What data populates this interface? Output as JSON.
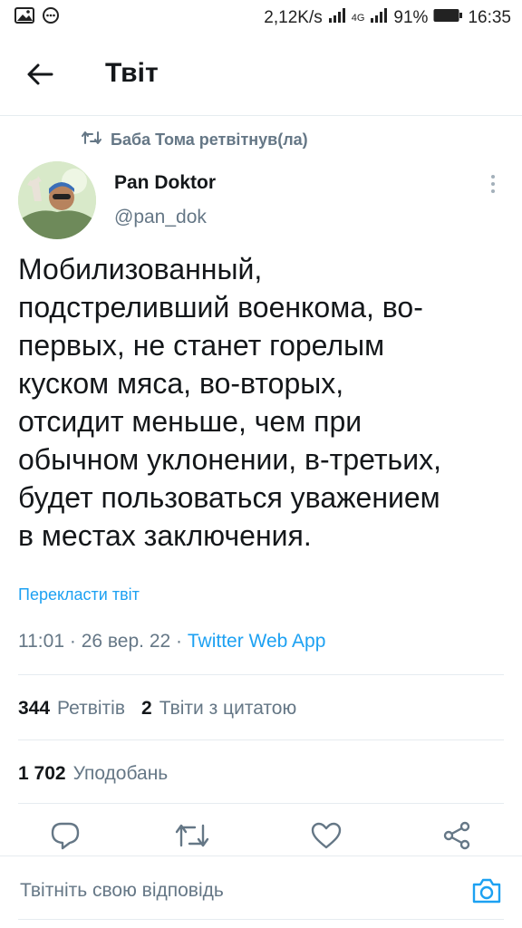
{
  "status_bar": {
    "speed": "2,12K/s",
    "network": "4G",
    "battery": "91%",
    "time": "16:35",
    "icons": [
      "image-icon",
      "messenger-icon",
      "signal-icon",
      "battery-icon"
    ]
  },
  "header": {
    "title": "Твіт",
    "back_icon": "arrow-left-icon"
  },
  "retweet": {
    "icon": "retweet-icon",
    "text": "Баба Тома ретвітнув(ла)"
  },
  "tweet": {
    "author_name": "Pan Doktor",
    "author_handle": "@pan_dok",
    "text": "Мобилизованный,\nподстреливший военкома, во-\nпервых, не станет горелым\nкуском мяса, во-вторых,\nотсидит меньше, чем при\nобычном уклонении, в-третьих,\nбудет пользоваться уважением\nв местах заключения.",
    "translate_label": "Перекласти твіт",
    "time": "11:01",
    "date": "26 вер. 22",
    "separator": "·",
    "source": "Twitter Web App"
  },
  "stats": {
    "retweets_count": "344",
    "retweets_label": "Ретвітів",
    "quotes_count": "2",
    "quotes_label": "Твіти з цитатою",
    "likes_count": "1 702",
    "likes_label": "Уподобань"
  },
  "actions": {
    "icons": [
      "reply-icon",
      "retweet-icon",
      "like-icon",
      "share-icon"
    ]
  },
  "reply": {
    "placeholder": "Твітніть свою відповідь",
    "camera_icon": "camera-icon"
  },
  "colors": {
    "accent": "#1da1f2",
    "muted": "#657786",
    "text": "#14171a",
    "divider": "#e6ecf0"
  }
}
